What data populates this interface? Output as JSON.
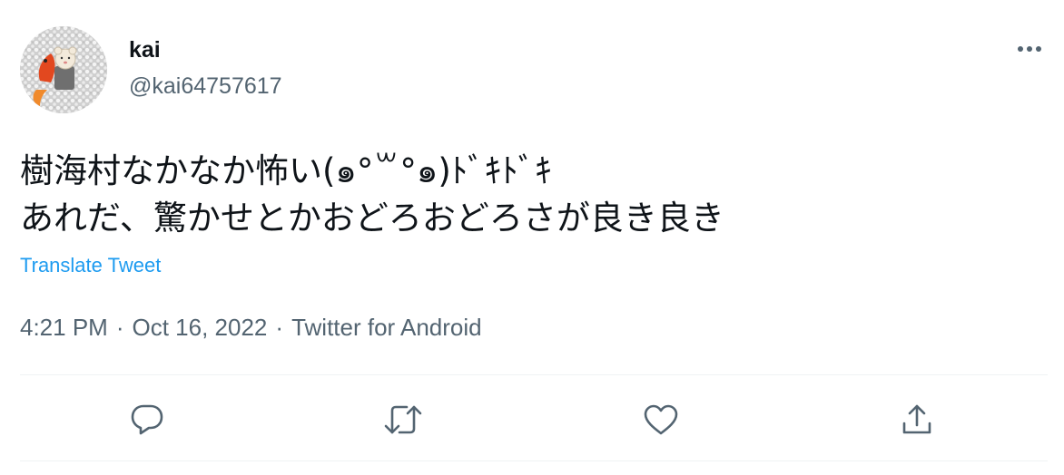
{
  "tweet": {
    "author": {
      "display_name": "kai",
      "handle": "@kai64757617"
    },
    "text_lines": [
      "樹海村なかなか怖い(๑°꒳°๑)ﾄﾞｷﾄﾞｷ",
      "あれだ、驚かせとかおどろおどろさが良き良き"
    ],
    "translate_label": "Translate Tweet",
    "time": "4:21 PM",
    "date": "Oct 16, 2022",
    "source": "Twitter for Android",
    "separator": "·"
  },
  "actions": [
    {
      "name": "reply",
      "icon": "reply-icon"
    },
    {
      "name": "retweet",
      "icon": "retweet-icon"
    },
    {
      "name": "like",
      "icon": "heart-icon"
    },
    {
      "name": "share",
      "icon": "share-icon"
    }
  ],
  "colors": {
    "text_primary": "#0f1419",
    "text_secondary": "#536471",
    "link": "#1d9bf0",
    "divider": "#eff3f4"
  }
}
